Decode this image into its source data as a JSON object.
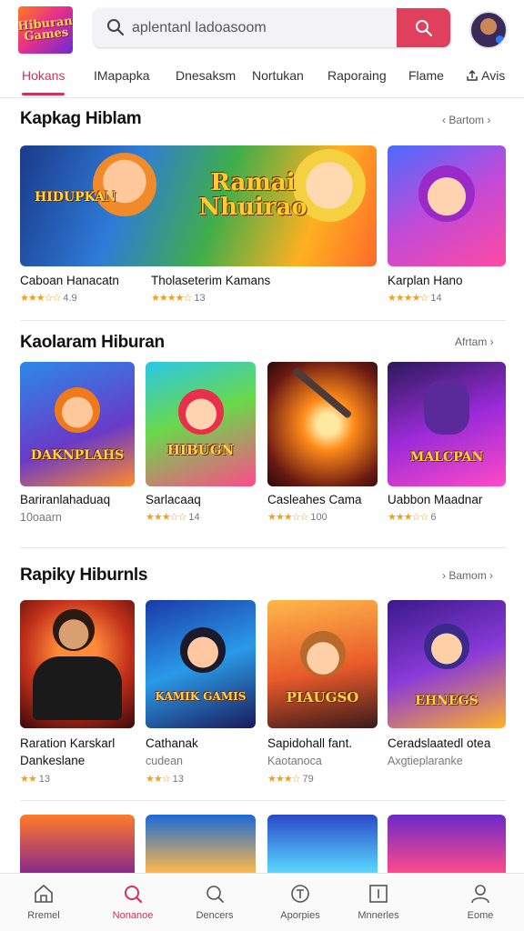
{
  "header": {
    "logo_text": "Hiburan Games",
    "search_placeholder": "aplentanl ladoasoom",
    "search_icon": "search-icon",
    "search_button_icon": "search-icon",
    "accent_color": "#e0405e"
  },
  "tabs": [
    {
      "label": "Hokans",
      "active": true
    },
    {
      "label": "IMapapka"
    },
    {
      "label": "Dnesaksm"
    },
    {
      "label": "Nortukan"
    },
    {
      "label": "Raporaing"
    },
    {
      "label": "Flame"
    },
    {
      "label": "Avis",
      "icon": "share-icon"
    }
  ],
  "sections": [
    {
      "title": "Kapkag Hiblam",
      "more": "Bartom",
      "cards": [
        {
          "title": "Caboan Hanacatn",
          "rating": "4.9",
          "stars": "★★★☆☆"
        },
        {
          "title": "Tholaseterim Kamans",
          "rating": "13",
          "stars": "★★★★☆"
        },
        {
          "title": "Karplan Hano",
          "rating": "14",
          "stars": "★★★★☆"
        }
      ],
      "banner_text": "Ramai Nhuirao",
      "banner_sub": "HIDUPKAN"
    },
    {
      "title": "Kaolaram Hiburan",
      "more": "Afrtam",
      "cards": [
        {
          "title": "Bariranlahaduaq",
          "sub": "10oaarn",
          "tag": "DAKNPLAHS"
        },
        {
          "title": "Sarlacaaq",
          "rating": "14",
          "stars": "★★★☆☆",
          "tag": "HIBUGN"
        },
        {
          "title": "Casleahes Cama",
          "rating": "100",
          "stars": "★★★☆☆",
          "tag": ""
        },
        {
          "title": "Uabbon Maadnar",
          "rating": "6",
          "stars": "★★★☆☆",
          "tag": "MALCPAN"
        }
      ]
    },
    {
      "title": "Rapiky Hiburnls",
      "more": "Bamom",
      "cards": [
        {
          "title": "Raration Karskarl",
          "sub": "Dankeslane",
          "rating": "13",
          "stars": "★★",
          "tag": ""
        },
        {
          "title": "Cathanak",
          "sub": "cudean",
          "rating": "13",
          "stars": "★★☆",
          "tag": "KAMIK GAMIS"
        },
        {
          "title": "Sapidohall fant.",
          "sub": "Kaotanoca",
          "rating": "79",
          "stars": "★★★☆",
          "tag": "PIAUGSO"
        },
        {
          "title": "Ceradslaatedl otea",
          "sub": "Axgtieplaranke",
          "tag": "EHNEGS"
        }
      ]
    }
  ],
  "bottom_nav": [
    {
      "label": "Rremel",
      "icon": "home-icon"
    },
    {
      "label": "Nonanoe",
      "icon": "search-icon",
      "active": true
    },
    {
      "label": "Dencers",
      "icon": "magnifier-icon"
    },
    {
      "label": "Aporpies",
      "icon": "compass-icon"
    },
    {
      "label": "Mnnerles",
      "icon": "library-icon"
    },
    {
      "label": "Eome",
      "icon": "profile-icon"
    }
  ]
}
